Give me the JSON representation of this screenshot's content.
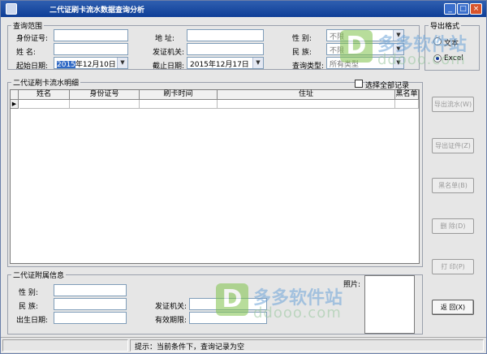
{
  "window": {
    "title": "二代证刷卡流水数据查询分析"
  },
  "query": {
    "group_label": "查询范围",
    "id_label": "身份证号:",
    "id_value": "",
    "name_label": "姓    名:",
    "name_value": "",
    "address_label": "地    址:",
    "address_value": "",
    "issuer_label": "发证机关:",
    "issuer_value": "",
    "gender_label": "性    别:",
    "gender_value": "不限",
    "ethnic_label": "民    族:",
    "ethnic_value": "不限",
    "start_label": "起始日期:",
    "start_sel": "2015",
    "start_rest": "年12月10日",
    "end_label": "截止日期:",
    "end_value": "2015年12月17日",
    "type_label": "查询类型:",
    "type_value": "所有类型"
  },
  "export": {
    "group_label": "导出格式",
    "text_label": "文本",
    "excel_label": "Excel",
    "selected": "Excel"
  },
  "detail": {
    "group_label": "二代证刷卡流水明细",
    "select_all_label": "选择全部记录",
    "columns": [
      "姓名",
      "身份证号",
      "刷卡时间",
      "住址",
      "黑名单"
    ],
    "row_indicator": "▶"
  },
  "buttons": {
    "export_flow": "导出流水(W)",
    "export_cert": "导出证件(Z)",
    "blacklist": "黑名单(B)",
    "delete": "删 除(D)",
    "print": "打 印(P)",
    "back": "返 回(X)"
  },
  "attach": {
    "group_label": "二代证附属信息",
    "gender_label": "性    别:",
    "ethnic_label": "民    族:",
    "birth_label": "出生日期:",
    "issuer_label": "发证机关:",
    "valid_label": "有效期限:",
    "photo_label": "照片:"
  },
  "status": {
    "hint": "提示：当前条件下，查询记录为空"
  },
  "watermark": {
    "cn": "多多软件站",
    "en": "ddooo.com",
    "logo": "D"
  },
  "colors": {
    "title_bar": "#0e3e97",
    "selection": "#316ac5",
    "close_button": "#d8542c"
  }
}
